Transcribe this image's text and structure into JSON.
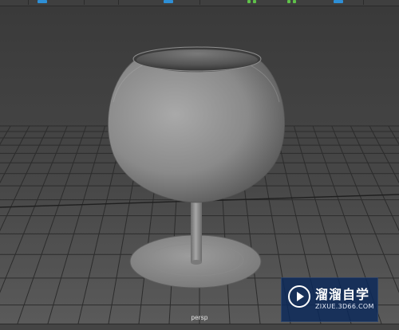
{
  "viewport": {
    "camera_label": "persp"
  },
  "watermark": {
    "brand": "溜溜自学",
    "url": "ZIXUE.3D66.COM"
  },
  "colors": {
    "viewport_bg_top": "#3b3b3b",
    "viewport_bg_bottom": "#555555",
    "grid_line": "#2e2e2e",
    "model_base": "#8c8c8c",
    "toolbar_highlight": "#2e8fd6",
    "toolbar_ok": "#5fc24a",
    "watermark_bg": "#0f2f63"
  },
  "icons": {
    "watermark_logo": "play-circle-icon"
  }
}
